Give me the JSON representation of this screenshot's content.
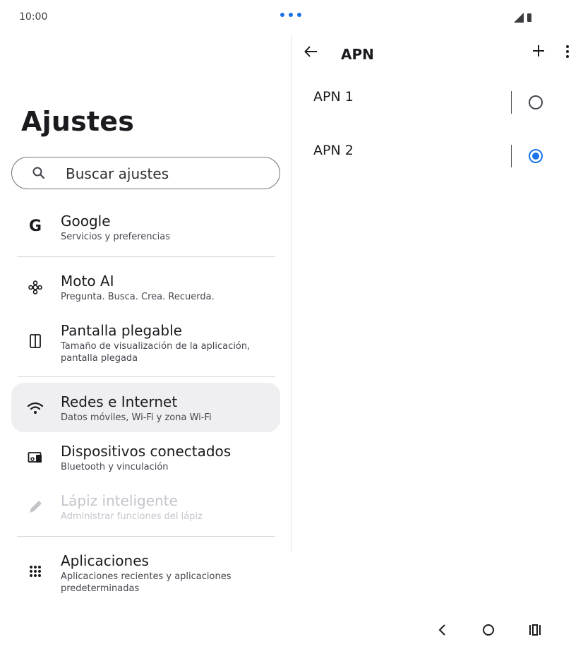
{
  "status_bar": {
    "time": "10:00"
  },
  "left_pane": {
    "title": "Ajustes",
    "search": {
      "placeholder": "Buscar ajustes"
    },
    "items": [
      {
        "title": "Google",
        "subtitle": "Servicios y preferencias",
        "icon": "google-icon"
      },
      {
        "title": "Moto AI",
        "subtitle": "Pregunta. Busca. Crea. Recuerda.",
        "icon": "ai-sparkle-icon"
      },
      {
        "title": "Pantalla plegable",
        "subtitle": "Tamaño de visualización de la aplicación, pantalla plegada",
        "icon": "foldable-icon"
      },
      {
        "title": "Redes e Internet",
        "subtitle": "Datos móviles, Wi-Fi y zona Wi-Fi",
        "icon": "wifi-icon",
        "selected": true
      },
      {
        "title": "Dispositivos conectados",
        "subtitle": "Bluetooth y vinculación",
        "icon": "devices-icon"
      },
      {
        "title": "Lápiz inteligente",
        "subtitle": "Administrar funciones del lápiz",
        "icon": "pen-icon",
        "disabled": true
      },
      {
        "title": "Aplicaciones",
        "subtitle": "Aplicaciones recientes y aplicaciones predeterminadas",
        "icon": "apps-grid-icon"
      }
    ]
  },
  "right_pane": {
    "title": "APN",
    "apns": [
      {
        "label": "APN 1",
        "selected": false
      },
      {
        "label": "APN 2",
        "selected": true
      }
    ]
  },
  "colors": {
    "accent": "#1a73e8",
    "highlight_bg": "#efeff1",
    "disabled_text": "#c4c5cb"
  }
}
